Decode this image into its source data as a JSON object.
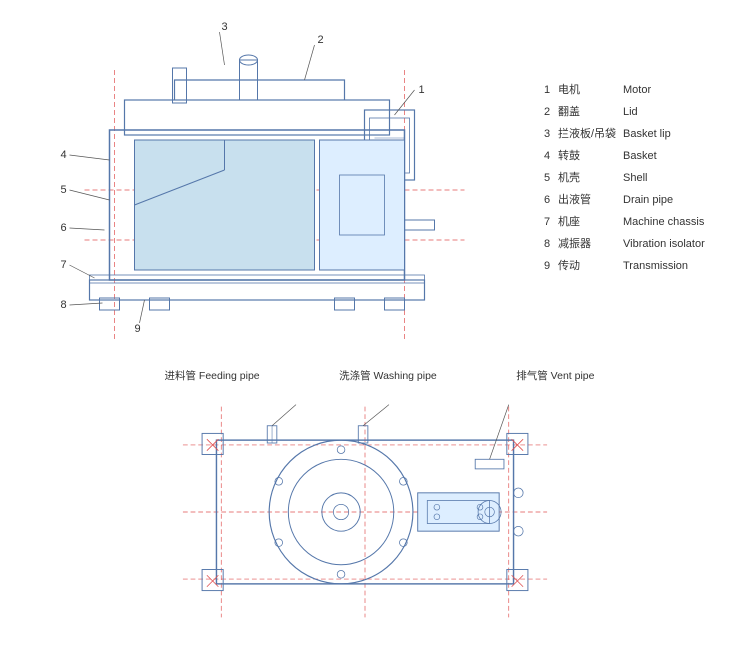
{
  "legend": {
    "items": [
      {
        "num": "1",
        "cn": "电机",
        "en": "Motor"
      },
      {
        "num": "2",
        "cn": "翻盖",
        "en": "Lid"
      },
      {
        "num": "3",
        "cn": "拦液板/吊袋",
        "en": "Basket lip"
      },
      {
        "num": "4",
        "cn": "转鼓",
        "en": "Basket"
      },
      {
        "num": "5",
        "cn": "机壳",
        "en": "Shell"
      },
      {
        "num": "6",
        "cn": "出液管",
        "en": "Drain pipe"
      },
      {
        "num": "7",
        "cn": "机座",
        "en": "Machine chassis"
      },
      {
        "num": "8",
        "cn": "减振器",
        "en": "Vibration isolator"
      },
      {
        "num": "9",
        "cn": "传动",
        "en": "Transmission"
      }
    ]
  },
  "bottom_labels": [
    {
      "text": "进料管 Feeding pipe"
    },
    {
      "text": "洗涤管 Washing pipe"
    },
    {
      "text": "排气管 Vent pipe"
    }
  ],
  "callouts": {
    "top": [
      "1",
      "2",
      "3",
      "4",
      "5",
      "6",
      "7",
      "8",
      "9"
    ]
  }
}
